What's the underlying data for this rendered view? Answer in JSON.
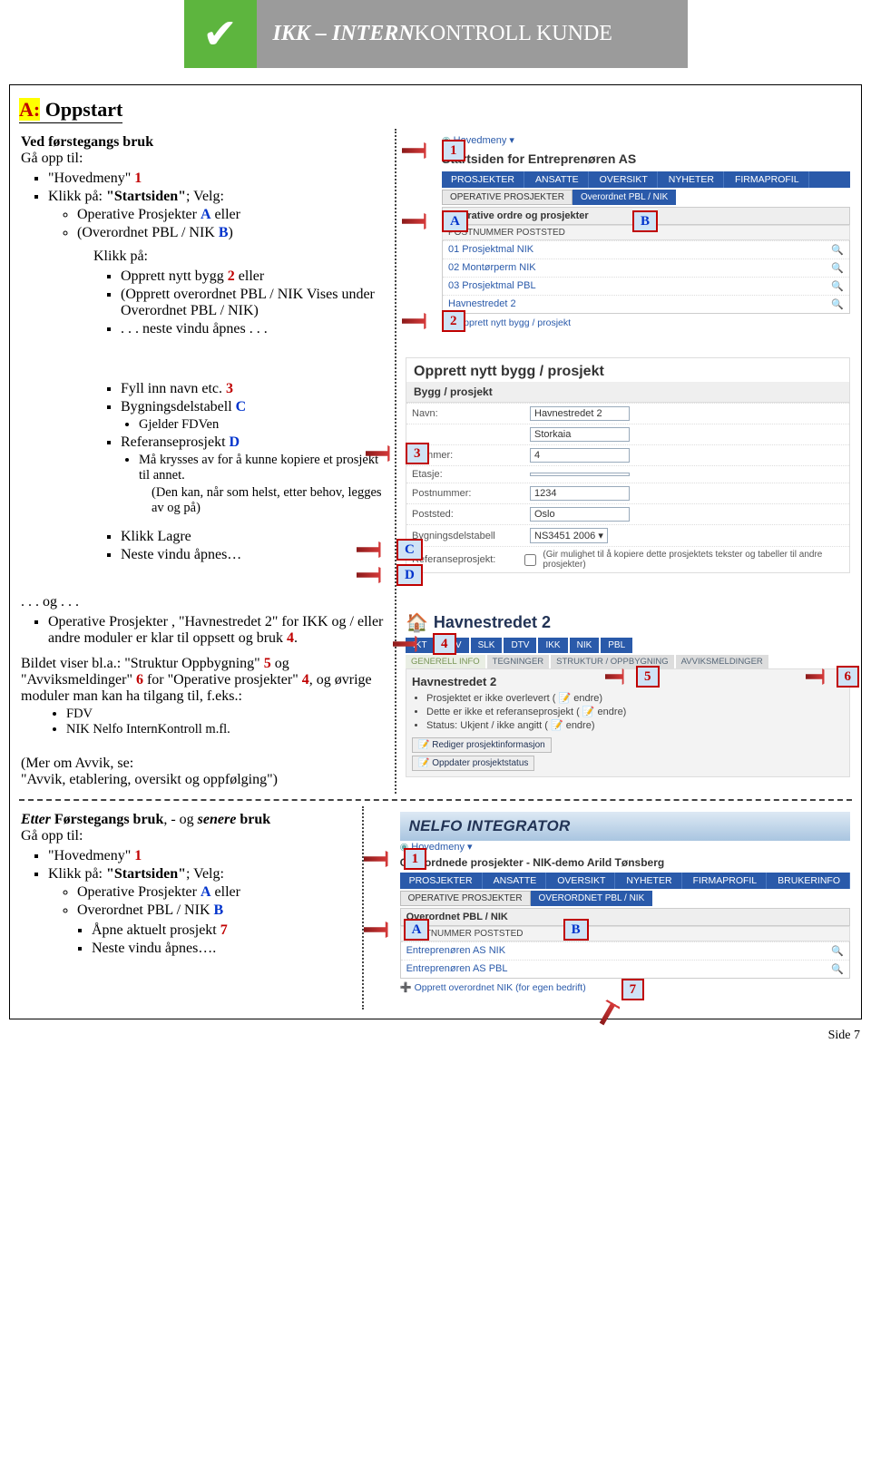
{
  "banner": {
    "title_pre": "IKK – ",
    "title_em": "INTERN",
    "title_post": "KONTROLL KUNDE"
  },
  "section_title": {
    "prefix": "A:",
    "text": " Oppstart"
  },
  "block1": {
    "heading": "Ved førstegangs bruk",
    "line_gaopp": "Gå opp til:",
    "li_hm": "\"Hovedmeny\" ",
    "li_hm_num": "1",
    "li_klikk": "Klikk på: ",
    "li_klikk_b": "\"Startsiden\"",
    "li_klikk_post": "; Velg:",
    "sub_a": "Operative Prosjekter ",
    "sub_a_ref": "A",
    "sub_a_post": " eller",
    "sub_b": "(Overordnet PBL / NIK ",
    "sub_b_ref": "B",
    "sub_b_post": ")",
    "klikkpa": "Klikk på:",
    "li2_1": "Opprett nytt bygg ",
    "li2_1_num": "2",
    "li2_1_post": " eller",
    "li2_2": "(Opprett overordnet PBL / NIK Vises under Overordnet PBL / NIK)",
    "li2_3": ". . . neste vindu åpnes . . ."
  },
  "block2": {
    "li_fyll": "Fyll inn navn etc. ",
    "li_fyll_num": "3",
    "li_bygg": "Bygningsdelstabell ",
    "li_bygg_ref": "C",
    "sub_gjelder": "Gjelder FDVen",
    "li_ref": "Referanseprosjekt ",
    "li_ref_ref": "D",
    "sub_ref1": "Må krysses av for å kunne kopiere et prosjekt til annet.",
    "sub_ref2": "(Den kan, når som helst, etter behov, legges av og på)",
    "li_lagre": "Klikk Lagre",
    "li_neste": "Neste vindu åpnes…"
  },
  "block3": {
    "og": ". . . og . . .",
    "li": "Operative Prosjekter , \"Havnestredet 2\"  for IKK og / eller andre moduler er klar til oppsett og bruk ",
    "li_num": "4",
    "li_post": ".",
    "para1_pre": "Bildet viser bl.a.: \"Struktur Oppbygning\" ",
    "para1_n5": "5",
    "para1_mid": " og \"Avviksmeldinger\" ",
    "para1_n6": "6",
    "para1_mid2": " for \"Operative prosjekter\"  ",
    "para1_n4": "4",
    "para1_post": ", og øvrige moduler man kan ha tilgang til, f.eks.:",
    "bul_fdv": "FDV",
    "bul_nik": "NIK Nelfo InternKontroll m.fl.",
    "mer": "(Mer om Avvik, se:\n\"Avvik, etablering, oversikt og oppfølging\")"
  },
  "block4": {
    "heading_pre": "Etter ",
    "heading_b1": "Førstegangs bruk",
    "heading_mid": ", - og ",
    "heading_i": "senere",
    "heading_post": " bruk",
    "line_gaopp": "Gå opp til:",
    "li_hm": "\"Hovedmeny\" ",
    "li_hm_num": "1",
    "li_klikk": "Klikk på: ",
    "li_klikk_b": "\"Startsiden\"",
    "li_klikk_post": "; Velg:",
    "sub_a": "Operative Prosjekter ",
    "sub_a_ref": "A",
    "sub_a_post": " eller",
    "sub_b": "Overordnet PBL / NIK ",
    "sub_b_ref": "B",
    "sq_apne": "Åpne aktuelt prosjekt  ",
    "sq_apne_num": "7",
    "sq_neste": "Neste vindu åpnes…."
  },
  "shot1": {
    "hm": "Hovedmeny ▾",
    "title": "Startsiden for Entreprenøren AS",
    "tabs": [
      "PROSJEKTER",
      "ANSATTE",
      "OVERSIKT",
      "NYHETER",
      "FIRMAPROFIL"
    ],
    "subtab1": "OPERATIVE PROSJEKTER",
    "subtab2": "Overordnet PBL / NIK",
    "panel": "Operative ordre og prosjekter",
    "sub": "POSTNUMMER  POSTSTED",
    "rows": [
      "01 Prosjektmal NIK",
      "02 Montørperm NIK",
      "03 Prosjektmal PBL",
      "Havnestredet 2"
    ],
    "link": "Opprett nytt bygg / prosjekt"
  },
  "shot2": {
    "title": "Opprett nytt bygg / prosjekt",
    "fhead": "Bygg / prosjekt",
    "rows": [
      {
        "lbl": "Navn:",
        "val": "Havnestredet 2"
      },
      {
        "lbl": "",
        "val": "Storkaia"
      },
      {
        "lbl": "Nummer:",
        "val": "4"
      },
      {
        "lbl": "Etasje:",
        "val": ""
      },
      {
        "lbl": "Postnummer:",
        "val": "1234"
      },
      {
        "lbl": "Poststed:",
        "val": "Oslo"
      },
      {
        "lbl": "Bygningsdelstabell",
        "val": "NS3451 2006 ▾"
      },
      {
        "lbl": "Referanseprosjekt:",
        "val": ""
      }
    ],
    "note": "(Gir mulighet til å kopiere dette prosjektets tekster og tabeller til andre prosjekter)"
  },
  "shot3": {
    "title": "Havnestredet 2",
    "tabs": [
      "IKT",
      "FDV",
      "SLK",
      "DTV",
      "IKK",
      "NIK",
      "PBL"
    ],
    "subtabs": [
      "GENERELL INFO",
      "TEGNINGER",
      "STRUKTUR / OPPBYGNING",
      "AVVIKSMELDINGER"
    ],
    "ph": "Havnestredet 2",
    "bullets": [
      "Prosjektet er ikke overlevert ( 📝 endre)",
      "Dette er ikke et referanseprosjekt ( 📝 endre)",
      "Status: Ukjent / ikke angitt ( 📝 endre)"
    ],
    "btn1": "Rediger prosjektinformasjon",
    "btn2": "Oppdater prosjektstatus"
  },
  "shot4": {
    "brand": "NELFO INTEGRATOR",
    "hm": "Hovedmeny ▾",
    "title": "Overordnede prosjekter - NIK-demo Arild Tønsberg",
    "tabs": [
      "PROSJEKTER",
      "ANSATTE",
      "OVERSIKT",
      "NYHETER",
      "FIRMAPROFIL",
      "BRUKERINFO"
    ],
    "subtab1": "OPERATIVE PROSJEKTER",
    "subtab2": "OVERORDNET PBL / NIK",
    "panel": "Overordnet PBL / NIK",
    "sub": "POSTNUMMER  POSTSTED",
    "rows": [
      "Entreprenøren AS NIK",
      "Entreprenøren AS PBL"
    ],
    "link": "Opprett overordnet NIK (for egen bedrift)"
  },
  "markers": {
    "m1": "1",
    "m2": "2",
    "m3": "3",
    "m4": "4",
    "m5": "5",
    "m6": "6",
    "m7": "7",
    "mA": "A",
    "mB": "B",
    "mC": "C",
    "mD": "D"
  },
  "footer": "Side 7"
}
